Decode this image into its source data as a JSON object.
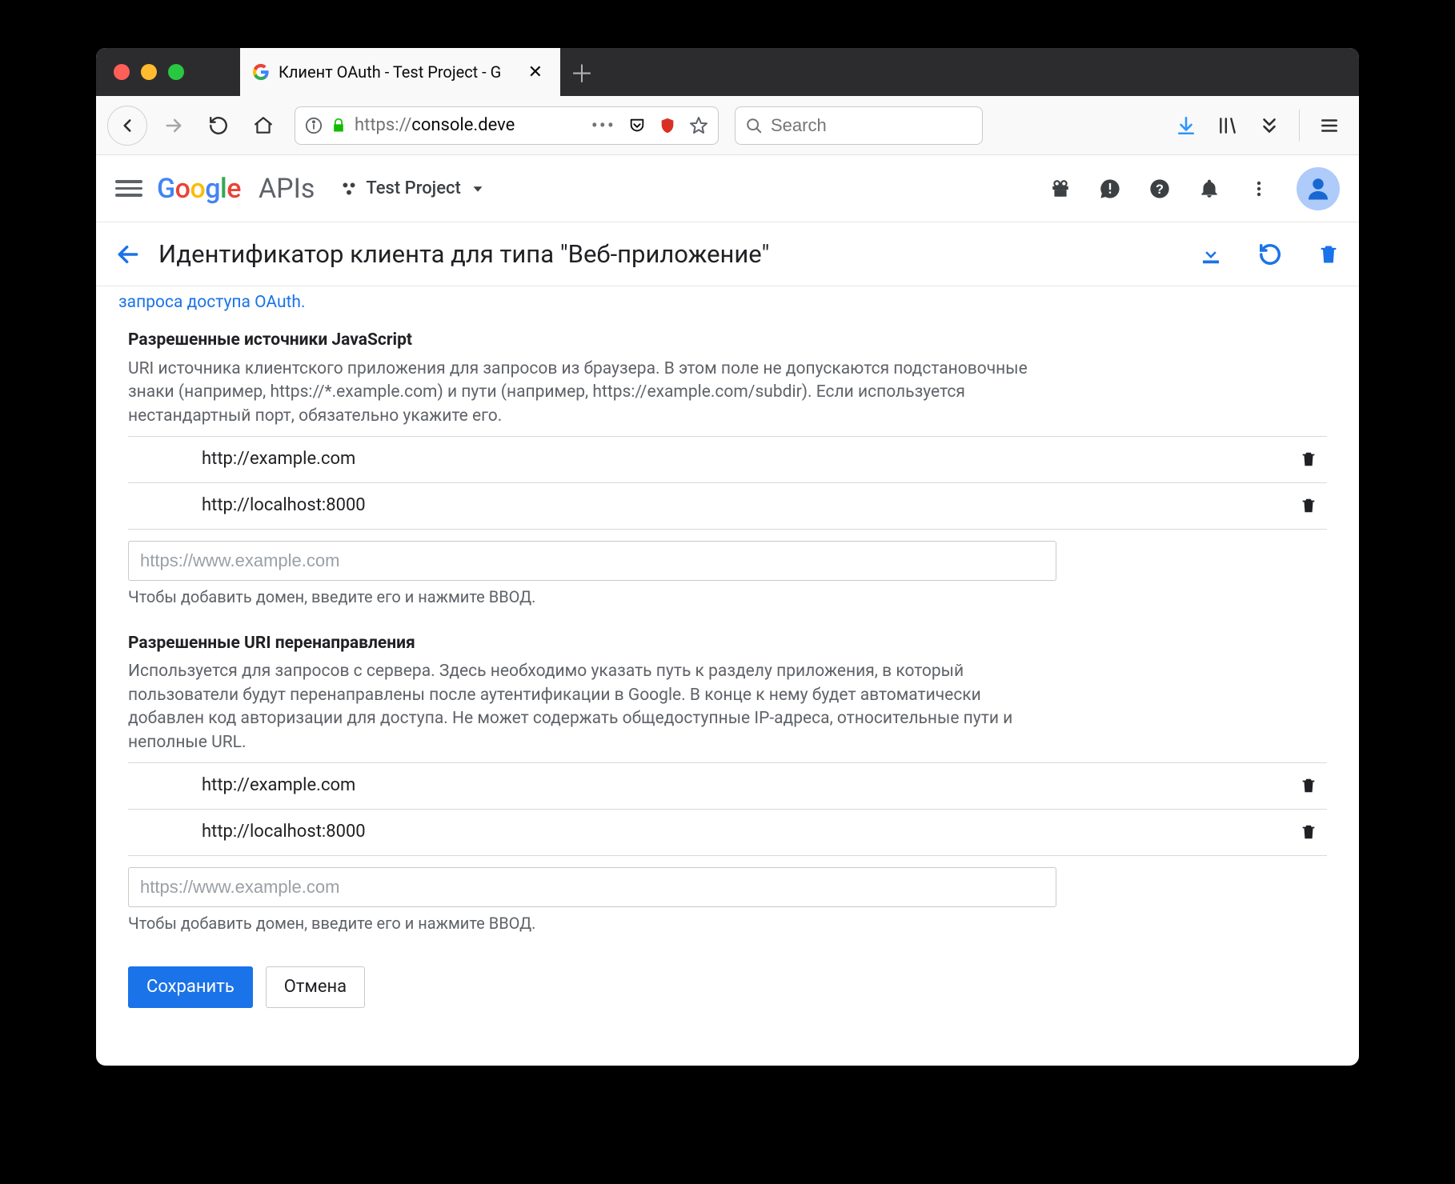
{
  "browser": {
    "tab_title": "Клиент OAuth - Test Project - G",
    "url_display_prefix": "https://",
    "url_display_host": "console.deve",
    "search_placeholder": "Search"
  },
  "header": {
    "logo_suffix": "APIs",
    "project_label": "Test Project"
  },
  "page": {
    "title": "Идентификатор клиента для типа \"Веб-приложение\"",
    "oauth_link_fragment": "запроса доступа OAuth."
  },
  "js_origins": {
    "heading": "Разрешенные источники JavaScript",
    "description": "URI источника клиентского приложения для запросов из браузера. В этом поле не допускаются подстановочные знаки (например, https://*.example.com) и пути (например, https://example.com/subdir). Если используется нестандартный порт, обязательно укажите его.",
    "items": [
      "http://example.com",
      "http://localhost:8000"
    ],
    "add_placeholder": "https://www.example.com",
    "hint": "Чтобы добавить домен, введите его и нажмите ВВОД."
  },
  "redirect_uris": {
    "heading": "Разрешенные URI перенаправления",
    "description": "Используется для запросов с сервера. Здесь необходимо указать путь к разделу приложения, в который пользователи будут перенаправлены после аутентификации в Google. В конце к нему будет автоматически добавлен код авторизации для доступа. Не может содержать общедоступные IP-адреса, относительные пути и неполные URL.",
    "items": [
      "http://example.com",
      "http://localhost:8000"
    ],
    "add_placeholder": "https://www.example.com",
    "hint": "Чтобы добавить домен, введите его и нажмите ВВОД."
  },
  "buttons": {
    "save": "Сохранить",
    "cancel": "Отмена"
  }
}
